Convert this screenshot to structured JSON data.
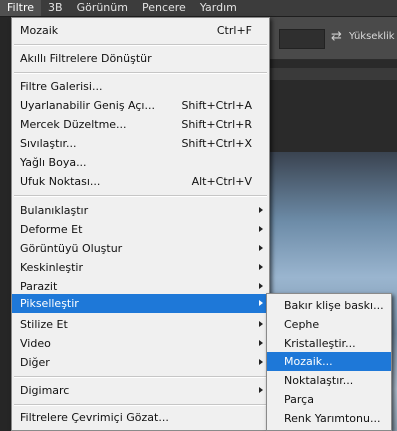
{
  "menubar": {
    "items": [
      "Filtre",
      "3B",
      "Görünüm",
      "Pencere",
      "Yardım"
    ]
  },
  "options_bar": {
    "text": "Yükseklik"
  },
  "filter_menu": {
    "last_filter": {
      "label": "Mozaik",
      "shortcut": "Ctrl+F"
    },
    "smart_filters": {
      "label": "Akıllı Filtrelere Dönüştür"
    },
    "gallery": {
      "label": "Filtre Galerisi..."
    },
    "adaptive_wide_angle": {
      "label": "Uyarlanabilir Geniş Açı...",
      "shortcut": "Shift+Ctrl+A"
    },
    "lens_correction": {
      "label": "Mercek Düzeltme...",
      "shortcut": "Shift+Ctrl+R"
    },
    "liquify": {
      "label": "Sıvılaştır...",
      "shortcut": "Shift+Ctrl+X"
    },
    "oil_paint": {
      "label": "Yağlı Boya..."
    },
    "vanishing_point": {
      "label": "Ufuk Noktası...",
      "shortcut": "Alt+Ctrl+V"
    },
    "blur": {
      "label": "Bulanıklaştır"
    },
    "distort": {
      "label": "Deforme Et"
    },
    "render": {
      "label": "Görüntüyü Oluştur"
    },
    "sharpen": {
      "label": "Keskinleştir"
    },
    "noise": {
      "label": "Parazit"
    },
    "pixelate": {
      "label": "Pikselleştir"
    },
    "stylize": {
      "label": "Stilize Et"
    },
    "video": {
      "label": "Video"
    },
    "other": {
      "label": "Diğer"
    },
    "digimarc": {
      "label": "Digimarc"
    },
    "browse_online": {
      "label": "Filtrelere Çevrimiçi Gözat..."
    }
  },
  "pixelate_submenu": {
    "items": [
      "Bakır klişe baskı...",
      "Cephe",
      "Kristalleştir...",
      "Mozaik...",
      "Noktalaştır...",
      "Parça",
      "Renk Yarımtonu..."
    ],
    "highlighted": "Mozaik..."
  },
  "colors": {
    "highlight": "#1e78d8",
    "menu_bg": "#f0f0f0",
    "app_bg": "#262626"
  }
}
